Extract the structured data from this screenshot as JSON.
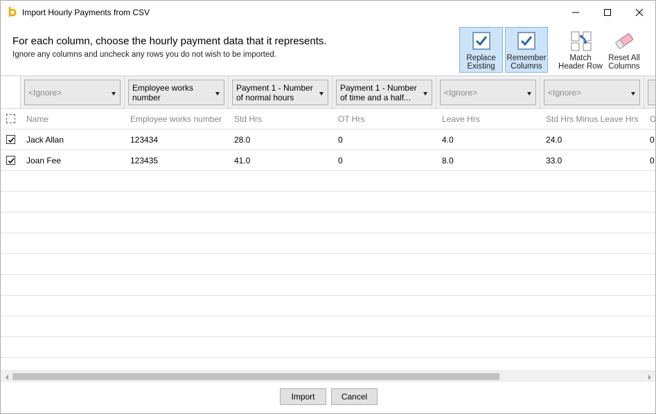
{
  "window": {
    "title": "Import Hourly Payments from CSV",
    "app_icon": "bp-logo-icon",
    "controls": [
      "minimize-icon",
      "maximize-icon",
      "close-icon"
    ]
  },
  "header": {
    "headline": "For each column, choose the hourly payment data that it represents.",
    "subline": "Ignore any columns and uncheck any rows you do not wish to be imported.",
    "tools": [
      {
        "line1": "Replace",
        "line2": "Existing",
        "icon": "checkbox-checked-icon",
        "active": true
      },
      {
        "line1": "Remember",
        "line2": "Columns",
        "icon": "checkbox-checked-icon",
        "active": true
      },
      {
        "line1": "Match",
        "line2": "Header Row",
        "icon": "match-columns-icon",
        "active": false
      },
      {
        "line1": "Reset All",
        "line2": "Columns",
        "icon": "eraser-icon",
        "active": false
      }
    ]
  },
  "mapping": [
    {
      "line1": "<Ignore>",
      "line2": "",
      "ignore": true
    },
    {
      "line1": "Employee works",
      "line2": "number",
      "ignore": false
    },
    {
      "line1": "Payment 1 - Number",
      "line2": "of normal hours",
      "ignore": false
    },
    {
      "line1": "Payment 1 - Number",
      "line2": "of time and a half...",
      "ignore": false
    },
    {
      "line1": "<Ignore>",
      "line2": "",
      "ignore": true
    },
    {
      "line1": "<Ignore>",
      "line2": "",
      "ignore": true
    }
  ],
  "table": {
    "columns": [
      "Name",
      "Employee works number",
      "Std Hrs",
      "OT Hrs",
      "Leave Hrs",
      "Std Hrs Minus Leave Hrs",
      "Ot"
    ],
    "rows": [
      {
        "checked": true,
        "cells": [
          "Jack Allan",
          "123434",
          "28.0",
          "0",
          "4.0",
          "24.0",
          "0"
        ]
      },
      {
        "checked": true,
        "cells": [
          "Joan Fee",
          "123435",
          "41.0",
          "0",
          "8.0",
          "33.0",
          "0"
        ]
      }
    ]
  },
  "footer": {
    "import_label": "Import",
    "cancel_label": "Cancel"
  },
  "colors": {
    "active_tool_bg": "#cde3f7",
    "active_tool_border": "#7eb4ea",
    "check_blue": "#2b67a8"
  }
}
